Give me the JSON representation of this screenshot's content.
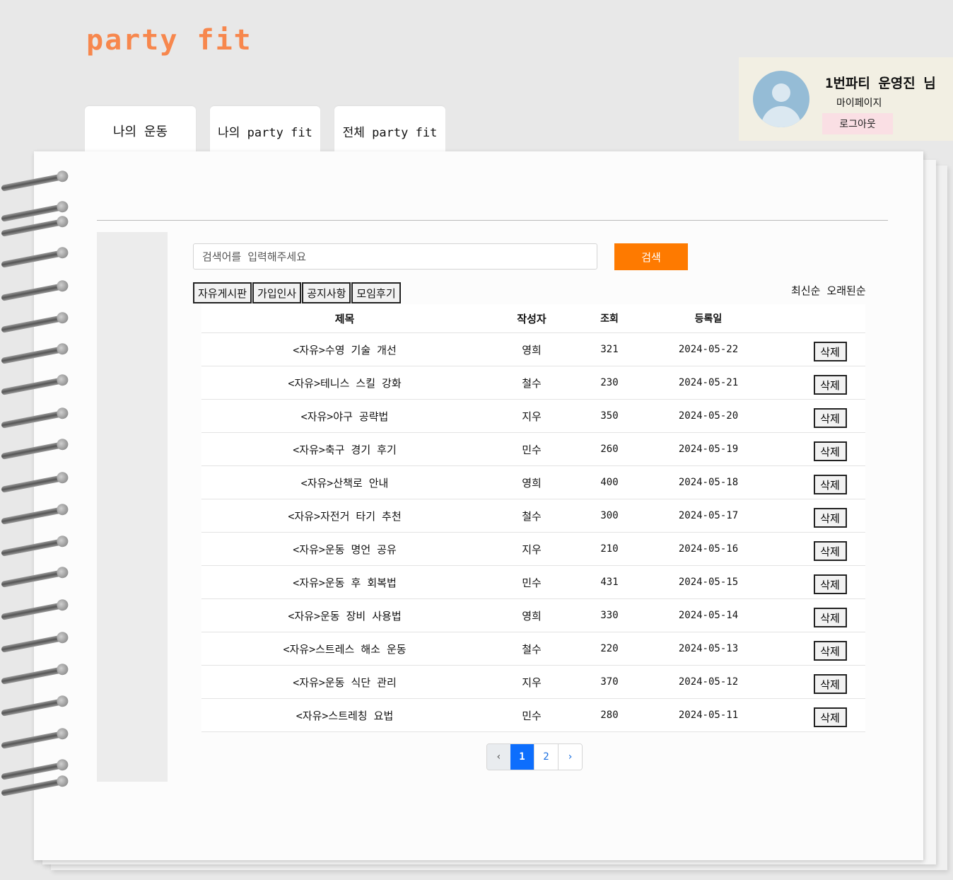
{
  "logo": "party fit",
  "tabs": [
    {
      "label": "나의 운동"
    },
    {
      "label": "나의 party fit"
    },
    {
      "label": "전체 party fit"
    }
  ],
  "profile": {
    "name": "1번파티 운영진 님",
    "mypage": "마이페이지",
    "logout": "로그아웃"
  },
  "search": {
    "placeholder": "검색어를 입력해주세요",
    "button": "검색"
  },
  "categories": [
    "자유게시판",
    "가입인사",
    "공지사항",
    "모임후기"
  ],
  "sort": {
    "latest": "최신순",
    "oldest": "오래된순"
  },
  "table": {
    "headers": {
      "title": "제목",
      "author": "작성자",
      "views": "조회",
      "date": "등록일"
    },
    "delete_label": "삭제",
    "rows": [
      {
        "title": "<자유>수영 기술 개선",
        "author": "영희",
        "views": "321",
        "date": "2024-05-22"
      },
      {
        "title": "<자유>테니스 스킬 강화",
        "author": "철수",
        "views": "230",
        "date": "2024-05-21"
      },
      {
        "title": "<자유>야구 공략법",
        "author": "지우",
        "views": "350",
        "date": "2024-05-20"
      },
      {
        "title": "<자유>축구 경기 후기",
        "author": "민수",
        "views": "260",
        "date": "2024-05-19"
      },
      {
        "title": "<자유>산책로 안내",
        "author": "영희",
        "views": "400",
        "date": "2024-05-18"
      },
      {
        "title": "<자유>자전거 타기 추천",
        "author": "철수",
        "views": "300",
        "date": "2024-05-17"
      },
      {
        "title": "<자유>운동 명언 공유",
        "author": "지우",
        "views": "210",
        "date": "2024-05-16"
      },
      {
        "title": "<자유>운동 후 회복법",
        "author": "민수",
        "views": "431",
        "date": "2024-05-15"
      },
      {
        "title": "<자유>운동 장비 사용법",
        "author": "영희",
        "views": "330",
        "date": "2024-05-14"
      },
      {
        "title": "<자유>스트레스 해소 운동",
        "author": "철수",
        "views": "220",
        "date": "2024-05-13"
      },
      {
        "title": "<자유>운동 식단 관리",
        "author": "지우",
        "views": "370",
        "date": "2024-05-12"
      },
      {
        "title": "<자유>스트레칭 요법",
        "author": "민수",
        "views": "280",
        "date": "2024-05-11"
      }
    ]
  },
  "pagination": {
    "prev": "‹",
    "pages": [
      "1",
      "2"
    ],
    "current": "1",
    "next": "›"
  },
  "colors": {
    "brand": "#f7874d",
    "search_button": "#fe7a00",
    "pager_active": "#0d6efd",
    "logout_bg": "#fadfe4"
  }
}
